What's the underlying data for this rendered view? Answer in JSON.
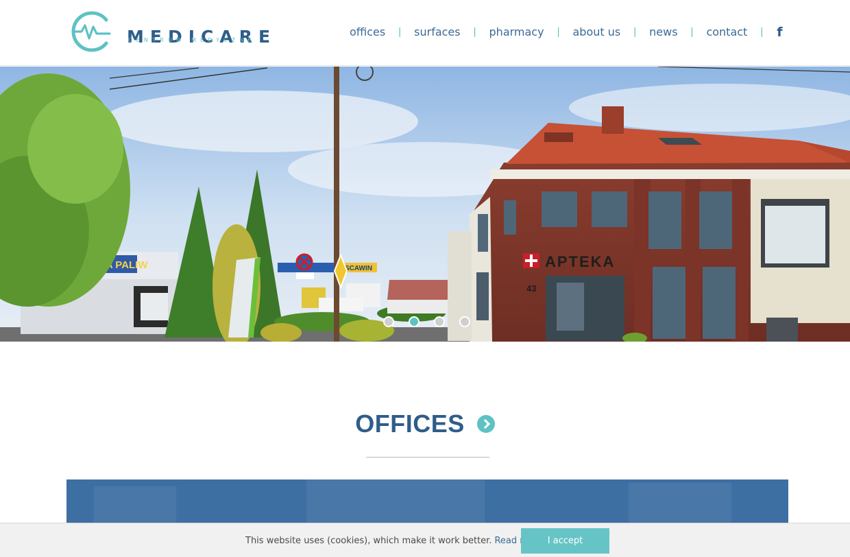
{
  "brand": {
    "title": "MEDICARE",
    "subtitle": "CENTRUM MEDYCZNE",
    "icon": "heartbeat-logo-icon",
    "primary_color": "#2f5d8a",
    "accent_color": "#5ec2c4"
  },
  "nav": {
    "items": [
      {
        "label": "offices"
      },
      {
        "label": "surfaces"
      },
      {
        "label": "pharmacy"
      },
      {
        "label": "about us"
      },
      {
        "label": "news"
      },
      {
        "label": "contact"
      }
    ],
    "separator": "|",
    "social_icon": "facebook-icon",
    "social_label": "f"
  },
  "hero": {
    "sign_apteka": "APTEKA",
    "sign_paliw": "NA PALIW",
    "sign_scawin": "SCAWIN",
    "house_number": "43",
    "slides": 4,
    "active_slide": 2
  },
  "section": {
    "title": "OFFICES",
    "arrow_icon": "chevron-right-circle-icon"
  },
  "cookie": {
    "text": "This website uses (cookies), which make it work better.",
    "link": "Read more",
    "button": "I accept"
  }
}
